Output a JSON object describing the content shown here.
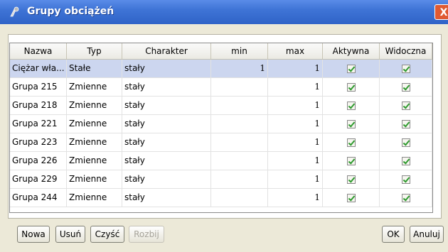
{
  "window": {
    "title": "Grupy obciążeń",
    "close_label": "X"
  },
  "table": {
    "columns": [
      "Nazwa",
      "Typ",
      "Charakter",
      "min",
      "max",
      "Aktywna",
      "Widoczna"
    ],
    "rows": [
      {
        "name": "Ciężar wła...",
        "type": "Stałe",
        "character": "stały",
        "min": "1",
        "max": "1",
        "aktywna": true,
        "widoczna": true,
        "selected": true
      },
      {
        "name": "Grupa 215",
        "type": "Zmienne",
        "character": "stały",
        "min": "",
        "max": "1",
        "aktywna": true,
        "widoczna": true
      },
      {
        "name": "Grupa 218",
        "type": "Zmienne",
        "character": "stały",
        "min": "",
        "max": "1",
        "aktywna": true,
        "widoczna": true
      },
      {
        "name": "Grupa 221",
        "type": "Zmienne",
        "character": "stały",
        "min": "",
        "max": "1",
        "aktywna": true,
        "widoczna": true
      },
      {
        "name": "Grupa 223",
        "type": "Zmienne",
        "character": "stały",
        "min": "",
        "max": "1",
        "aktywna": true,
        "widoczna": true
      },
      {
        "name": "Grupa 226",
        "type": "Zmienne",
        "character": "stały",
        "min": "",
        "max": "1",
        "aktywna": true,
        "widoczna": true
      },
      {
        "name": "Grupa 229",
        "type": "Zmienne",
        "character": "stały",
        "min": "",
        "max": "1",
        "aktywna": true,
        "widoczna": true
      },
      {
        "name": "Grupa 244",
        "type": "Zmienne",
        "character": "stały",
        "min": "",
        "max": "1",
        "aktywna": true,
        "widoczna": true
      }
    ]
  },
  "buttons": {
    "new": "Nowa",
    "delete": "Usuń",
    "clear": "Czyść",
    "split": "Rozbij",
    "ok": "OK",
    "cancel": "Anuluj"
  },
  "colors": {
    "titlebar": "#3f74d6",
    "selected_row": "#ccd6ef",
    "check": "#2f9a2f"
  }
}
